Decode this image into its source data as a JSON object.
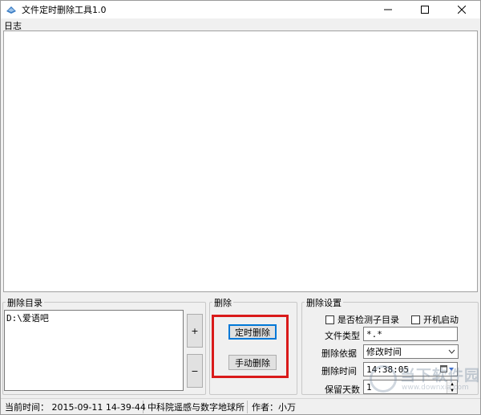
{
  "window": {
    "title": "文件定时删除工具1.0",
    "icon": "app-icon"
  },
  "log": {
    "label": "日志",
    "content": ""
  },
  "delete_dir": {
    "title": "删除目录",
    "items": [
      "D:\\爱语吧"
    ],
    "add_label": "+",
    "remove_label": "−"
  },
  "delete_group": {
    "title": "删除",
    "timed_label": "定时删除",
    "manual_label": "手动删除"
  },
  "settings": {
    "title": "删除设置",
    "check_subdirs_label": "是否检测子目录",
    "autostart_label": "开机启动",
    "file_type_label": "文件类型",
    "file_type_value": "*.*",
    "basis_label": "删除依据",
    "basis_value": "修改时间",
    "time_label": "删除时间",
    "time_value": "14:38:05",
    "keep_days_label": "保留天数",
    "keep_days_value": "1"
  },
  "status": {
    "current_time": "当前时间： 2015-09-11 14-39-44",
    "org": "中科院遥感与数字地球所",
    "author": "作者：小万"
  },
  "watermark": {
    "text": "当下软件园",
    "sub": "www.downxia.com"
  },
  "colors": {
    "highlight": "#d91a1a",
    "accent": "#0078d7"
  }
}
